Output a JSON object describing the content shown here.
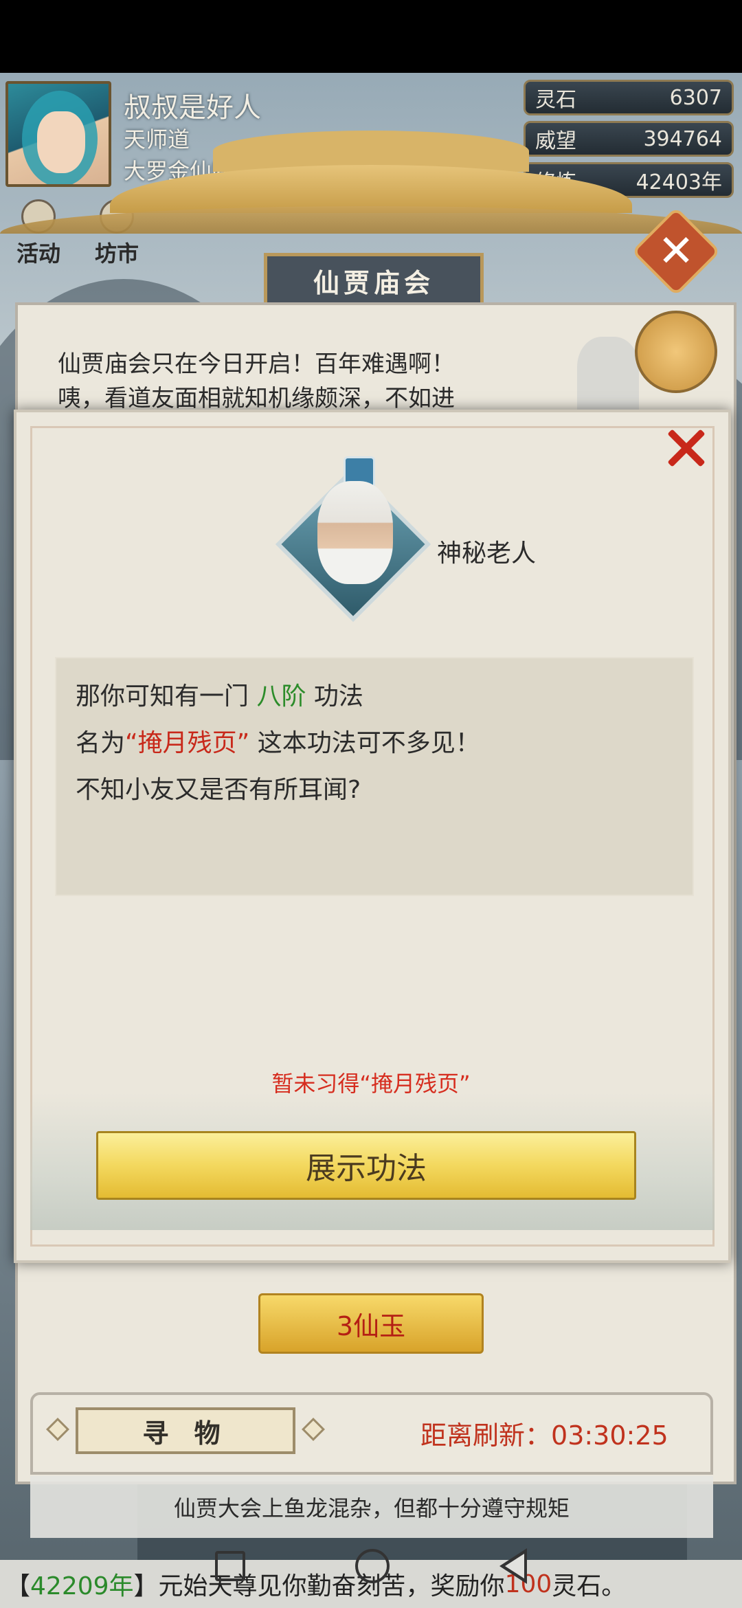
{
  "player": {
    "name": "叔叔是好人",
    "sect": "天师道",
    "rank": "大罗金仙四阶"
  },
  "stats": [
    {
      "label": "灵石",
      "value": "6307"
    },
    {
      "label": "威望",
      "value": "394764"
    },
    {
      "label": "修炼",
      "value": "42403年"
    }
  ],
  "quick_menu": [
    {
      "label": "活动",
      "icon": "coin-icon"
    },
    {
      "label": "坊市",
      "icon": "market-icon"
    }
  ],
  "banner": {
    "title": "仙贾庙会"
  },
  "background_text": [
    "仙贾庙会只在今日开启！百年难遇啊！",
    "咦，看道友面相就知机缘颇深，不如进"
  ],
  "dialog": {
    "npc_name": "神秘老人",
    "lines": [
      {
        "pre": "那你可知有一门 ",
        "highlight": "八阶",
        "post": " 功法"
      },
      {
        "pre": "名为",
        "highlight": "“掩月残页”",
        "post": " 这本功法可不多见！"
      },
      {
        "pre": "不知小友又是否有所耳闻?",
        "highlight": "",
        "post": ""
      }
    ],
    "notice": "暂未习得“掩月残页”",
    "button_label": "展示功法"
  },
  "price_button": "3仙玉",
  "seek": {
    "tag": "寻 物",
    "refresh_label": "距离刷新：",
    "refresh_time": "03:30:25"
  },
  "ticker": "仙贾大会上鱼龙混杂，但都十分遵守规矩",
  "news": {
    "prefix": "【",
    "year": "42209年",
    "middle": "】元始天尊见你勤奋刻苦，奖励你",
    "amount": "100",
    "suffix": "灵石。"
  },
  "colors": {
    "highlight_green": "#2c8c2a",
    "highlight_red": "#c8281a",
    "button_gold": "#f3d85e"
  }
}
